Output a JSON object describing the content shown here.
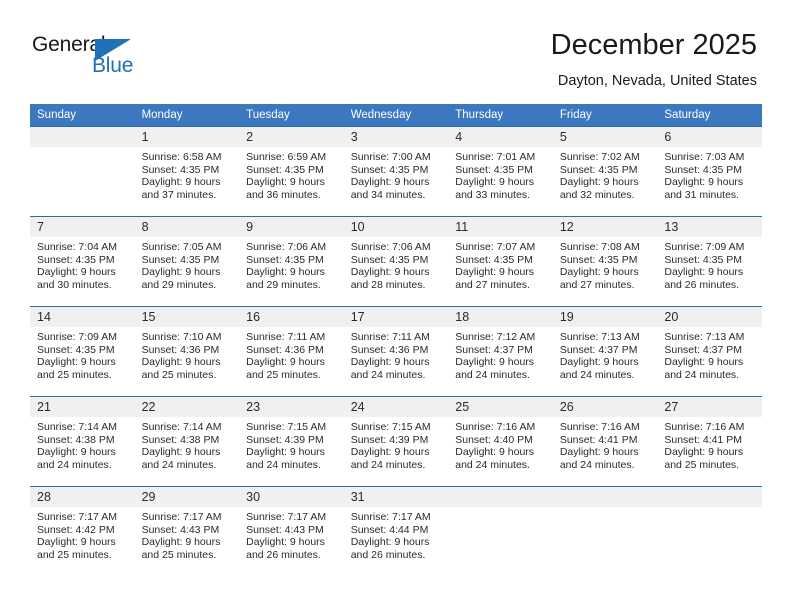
{
  "logo": {
    "word_top": "General",
    "word_bottom": "Blue",
    "accent_color": "#1f72b8",
    "triangle_icon": "triangle-icon"
  },
  "header": {
    "title": "December 2025",
    "subtitle": "Dayton, Nevada, United States"
  },
  "theme": {
    "header_blue": "#3b78c0",
    "divider_blue": "#2f6bab",
    "daynum_band": "#f0f0f0"
  },
  "weekdays": [
    "Sunday",
    "Monday",
    "Tuesday",
    "Wednesday",
    "Thursday",
    "Friday",
    "Saturday"
  ],
  "weeks": [
    [
      {
        "day": "",
        "sunrise": "",
        "sunset": "",
        "daylight1": "",
        "daylight2": ""
      },
      {
        "day": "1",
        "sunrise": "Sunrise: 6:58 AM",
        "sunset": "Sunset: 4:35 PM",
        "daylight1": "Daylight: 9 hours",
        "daylight2": "and 37 minutes."
      },
      {
        "day": "2",
        "sunrise": "Sunrise: 6:59 AM",
        "sunset": "Sunset: 4:35 PM",
        "daylight1": "Daylight: 9 hours",
        "daylight2": "and 36 minutes."
      },
      {
        "day": "3",
        "sunrise": "Sunrise: 7:00 AM",
        "sunset": "Sunset: 4:35 PM",
        "daylight1": "Daylight: 9 hours",
        "daylight2": "and 34 minutes."
      },
      {
        "day": "4",
        "sunrise": "Sunrise: 7:01 AM",
        "sunset": "Sunset: 4:35 PM",
        "daylight1": "Daylight: 9 hours",
        "daylight2": "and 33 minutes."
      },
      {
        "day": "5",
        "sunrise": "Sunrise: 7:02 AM",
        "sunset": "Sunset: 4:35 PM",
        "daylight1": "Daylight: 9 hours",
        "daylight2": "and 32 minutes."
      },
      {
        "day": "6",
        "sunrise": "Sunrise: 7:03 AM",
        "sunset": "Sunset: 4:35 PM",
        "daylight1": "Daylight: 9 hours",
        "daylight2": "and 31 minutes."
      }
    ],
    [
      {
        "day": "7",
        "sunrise": "Sunrise: 7:04 AM",
        "sunset": "Sunset: 4:35 PM",
        "daylight1": "Daylight: 9 hours",
        "daylight2": "and 30 minutes."
      },
      {
        "day": "8",
        "sunrise": "Sunrise: 7:05 AM",
        "sunset": "Sunset: 4:35 PM",
        "daylight1": "Daylight: 9 hours",
        "daylight2": "and 29 minutes."
      },
      {
        "day": "9",
        "sunrise": "Sunrise: 7:06 AM",
        "sunset": "Sunset: 4:35 PM",
        "daylight1": "Daylight: 9 hours",
        "daylight2": "and 29 minutes."
      },
      {
        "day": "10",
        "sunrise": "Sunrise: 7:06 AM",
        "sunset": "Sunset: 4:35 PM",
        "daylight1": "Daylight: 9 hours",
        "daylight2": "and 28 minutes."
      },
      {
        "day": "11",
        "sunrise": "Sunrise: 7:07 AM",
        "sunset": "Sunset: 4:35 PM",
        "daylight1": "Daylight: 9 hours",
        "daylight2": "and 27 minutes."
      },
      {
        "day": "12",
        "sunrise": "Sunrise: 7:08 AM",
        "sunset": "Sunset: 4:35 PM",
        "daylight1": "Daylight: 9 hours",
        "daylight2": "and 27 minutes."
      },
      {
        "day": "13",
        "sunrise": "Sunrise: 7:09 AM",
        "sunset": "Sunset: 4:35 PM",
        "daylight1": "Daylight: 9 hours",
        "daylight2": "and 26 minutes."
      }
    ],
    [
      {
        "day": "14",
        "sunrise": "Sunrise: 7:09 AM",
        "sunset": "Sunset: 4:35 PM",
        "daylight1": "Daylight: 9 hours",
        "daylight2": "and 25 minutes."
      },
      {
        "day": "15",
        "sunrise": "Sunrise: 7:10 AM",
        "sunset": "Sunset: 4:36 PM",
        "daylight1": "Daylight: 9 hours",
        "daylight2": "and 25 minutes."
      },
      {
        "day": "16",
        "sunrise": "Sunrise: 7:11 AM",
        "sunset": "Sunset: 4:36 PM",
        "daylight1": "Daylight: 9 hours",
        "daylight2": "and 25 minutes."
      },
      {
        "day": "17",
        "sunrise": "Sunrise: 7:11 AM",
        "sunset": "Sunset: 4:36 PM",
        "daylight1": "Daylight: 9 hours",
        "daylight2": "and 24 minutes."
      },
      {
        "day": "18",
        "sunrise": "Sunrise: 7:12 AM",
        "sunset": "Sunset: 4:37 PM",
        "daylight1": "Daylight: 9 hours",
        "daylight2": "and 24 minutes."
      },
      {
        "day": "19",
        "sunrise": "Sunrise: 7:13 AM",
        "sunset": "Sunset: 4:37 PM",
        "daylight1": "Daylight: 9 hours",
        "daylight2": "and 24 minutes."
      },
      {
        "day": "20",
        "sunrise": "Sunrise: 7:13 AM",
        "sunset": "Sunset: 4:37 PM",
        "daylight1": "Daylight: 9 hours",
        "daylight2": "and 24 minutes."
      }
    ],
    [
      {
        "day": "21",
        "sunrise": "Sunrise: 7:14 AM",
        "sunset": "Sunset: 4:38 PM",
        "daylight1": "Daylight: 9 hours",
        "daylight2": "and 24 minutes."
      },
      {
        "day": "22",
        "sunrise": "Sunrise: 7:14 AM",
        "sunset": "Sunset: 4:38 PM",
        "daylight1": "Daylight: 9 hours",
        "daylight2": "and 24 minutes."
      },
      {
        "day": "23",
        "sunrise": "Sunrise: 7:15 AM",
        "sunset": "Sunset: 4:39 PM",
        "daylight1": "Daylight: 9 hours",
        "daylight2": "and 24 minutes."
      },
      {
        "day": "24",
        "sunrise": "Sunrise: 7:15 AM",
        "sunset": "Sunset: 4:39 PM",
        "daylight1": "Daylight: 9 hours",
        "daylight2": "and 24 minutes."
      },
      {
        "day": "25",
        "sunrise": "Sunrise: 7:16 AM",
        "sunset": "Sunset: 4:40 PM",
        "daylight1": "Daylight: 9 hours",
        "daylight2": "and 24 minutes."
      },
      {
        "day": "26",
        "sunrise": "Sunrise: 7:16 AM",
        "sunset": "Sunset: 4:41 PM",
        "daylight1": "Daylight: 9 hours",
        "daylight2": "and 24 minutes."
      },
      {
        "day": "27",
        "sunrise": "Sunrise: 7:16 AM",
        "sunset": "Sunset: 4:41 PM",
        "daylight1": "Daylight: 9 hours",
        "daylight2": "and 25 minutes."
      }
    ],
    [
      {
        "day": "28",
        "sunrise": "Sunrise: 7:17 AM",
        "sunset": "Sunset: 4:42 PM",
        "daylight1": "Daylight: 9 hours",
        "daylight2": "and 25 minutes."
      },
      {
        "day": "29",
        "sunrise": "Sunrise: 7:17 AM",
        "sunset": "Sunset: 4:43 PM",
        "daylight1": "Daylight: 9 hours",
        "daylight2": "and 25 minutes."
      },
      {
        "day": "30",
        "sunrise": "Sunrise: 7:17 AM",
        "sunset": "Sunset: 4:43 PM",
        "daylight1": "Daylight: 9 hours",
        "daylight2": "and 26 minutes."
      },
      {
        "day": "31",
        "sunrise": "Sunrise: 7:17 AM",
        "sunset": "Sunset: 4:44 PM",
        "daylight1": "Daylight: 9 hours",
        "daylight2": "and 26 minutes."
      },
      {
        "day": "",
        "sunrise": "",
        "sunset": "",
        "daylight1": "",
        "daylight2": ""
      },
      {
        "day": "",
        "sunrise": "",
        "sunset": "",
        "daylight1": "",
        "daylight2": ""
      },
      {
        "day": "",
        "sunrise": "",
        "sunset": "",
        "daylight1": "",
        "daylight2": ""
      }
    ]
  ]
}
